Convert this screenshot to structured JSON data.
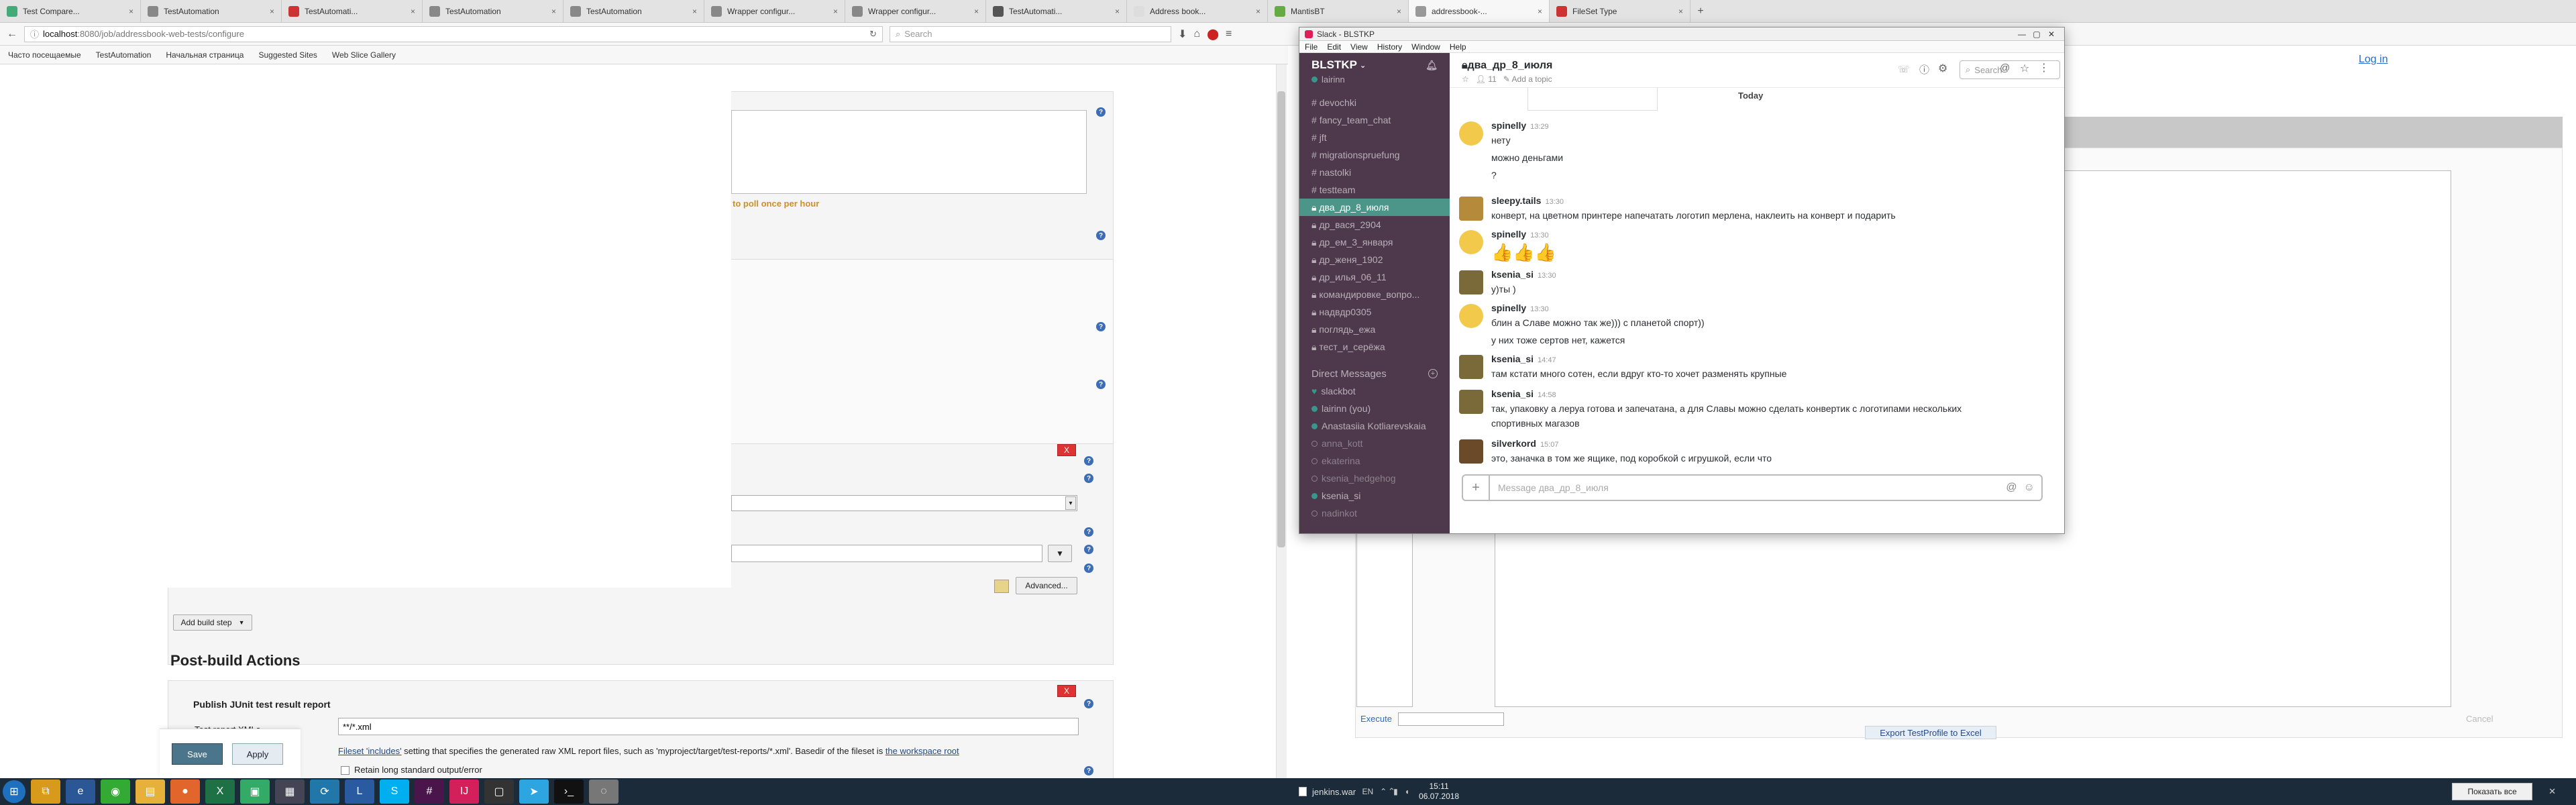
{
  "browser": {
    "tabs": [
      "Test Compare...",
      "TestAutomation",
      "TestAutomati...",
      "TestAutomation",
      "TestAutomation",
      "Wrapper configur...",
      "Wrapper configur...",
      "TestAutomati...",
      "Address book...",
      "MantisBT",
      "addressbook-...",
      "FileSet Type"
    ],
    "url_host": "localhost",
    "url_rest": ":8080/job/addressbook-web-tests/configure",
    "search_placeholder": "Search",
    "bookmarks": [
      "Часто посещаемые",
      "TestAutomation",
      "Начальная страница",
      "Suggested Sites",
      "Web Slice Gallery"
    ]
  },
  "jenkins": {
    "poll_hint": "to poll once per hour",
    "advanced_label": "Advanced...",
    "add_build_step_label": "Add build step",
    "post_build_title": "Post-build Actions",
    "junit_title": "Publish JUnit test result report",
    "test_report_label": "Test report XMLs",
    "test_report_value": "**/*.xml",
    "fileset_link": "Fileset 'includes'",
    "fileset_text": " setting that specifies the generated raw XML report files, such as 'myproject/target/test-reports/*.xml'. Basedir of the fileset is ",
    "workspace_link": "the workspace root",
    "retain_label": "Retain long standard output/error",
    "save_label": "Save",
    "apply_label": "Apply",
    "x_label": "X",
    "help_label": "?"
  },
  "right_app": {
    "login_label": "Log in",
    "execute_label": "Execute",
    "export_label": "Export TestProfile to Excel",
    "cancel_label": "Cancel"
  },
  "slack": {
    "window_title": "Slack - BLSTKP",
    "menu": [
      "File",
      "Edit",
      "View",
      "History",
      "Window",
      "Help"
    ],
    "workspace": "BLSTKP",
    "user": "lairinn",
    "channels": [
      "devochki",
      "fancy_team_chat",
      "jft",
      "migrationspruefung",
      "nastolki",
      "testteam",
      "два_др_8_июля",
      "др_вася_2904",
      "др_ем_3_января",
      "др_женя_1902",
      "др_илья_06_11",
      "командировке_вопро...",
      "надвдр0305",
      "поглядь_ежа",
      "тест_и_серёжа"
    ],
    "selected_channel": "два_др_8_июля",
    "dm_title": "Direct Messages",
    "dms": [
      {
        "name": "slackbot",
        "online": true
      },
      {
        "name": "lairinn (you)",
        "online": true
      },
      {
        "name": "Anastasiia Kotliarevskaia",
        "online": true
      },
      {
        "name": "anna_kott",
        "online": false
      },
      {
        "name": "ekaterina",
        "online": false
      },
      {
        "name": "ksenia_hedgehog",
        "online": false
      },
      {
        "name": "ksenia_si",
        "online": true
      },
      {
        "name": "nadinkot",
        "online": false
      }
    ],
    "channel_title": "два_др_8_июля",
    "member_count": "11",
    "add_topic": "Add a topic",
    "search_placeholder": "Search",
    "day_divider": "Today",
    "messages": [
      {
        "author": "spinelly",
        "time": "13:29",
        "lines": [
          "нету",
          "можно деньгами",
          "?"
        ]
      },
      {
        "author": "sleepy.tails",
        "time": "13:30",
        "lines": [
          "конверт, на цветном принтере напечатать логотип мерлена, наклеить на конверт и подарить"
        ]
      },
      {
        "author": "spinelly",
        "time": "13:30",
        "lines": [
          "👍👍👍"
        ]
      },
      {
        "author": "ksenia_si",
        "time": "13:30",
        "lines": [
          "у)ты )"
        ]
      },
      {
        "author": "spinelly",
        "time": "13:30",
        "lines": [
          "блин а Славе можно так же))) с планетой спорт))",
          "у них тоже сертов нет, кажется"
        ]
      },
      {
        "author": "ksenia_si",
        "time": "14:47",
        "lines": [
          "там кстати много сотен, если вдруг кто-то хочет разменять крупные"
        ]
      },
      {
        "author": "ksenia_si",
        "time": "14:58",
        "lines": [
          "так, упаковку а леруа готова и запечатана, а для Славы можно сделать конвертик с логотипами нескольких",
          "спортивных магазов"
        ]
      },
      {
        "author": "silverkord",
        "time": "15:07",
        "lines": [
          "это, заначка в том же ящике, под коробкой с игрушкой, если что"
        ]
      }
    ],
    "composer_placeholder": "Message два_др_8_июля"
  },
  "taskbar": {
    "lang": "EN",
    "time": "15:11",
    "date": "06.07.2018",
    "download_file": "jenkins.war",
    "show_all_label": "Показать все"
  }
}
